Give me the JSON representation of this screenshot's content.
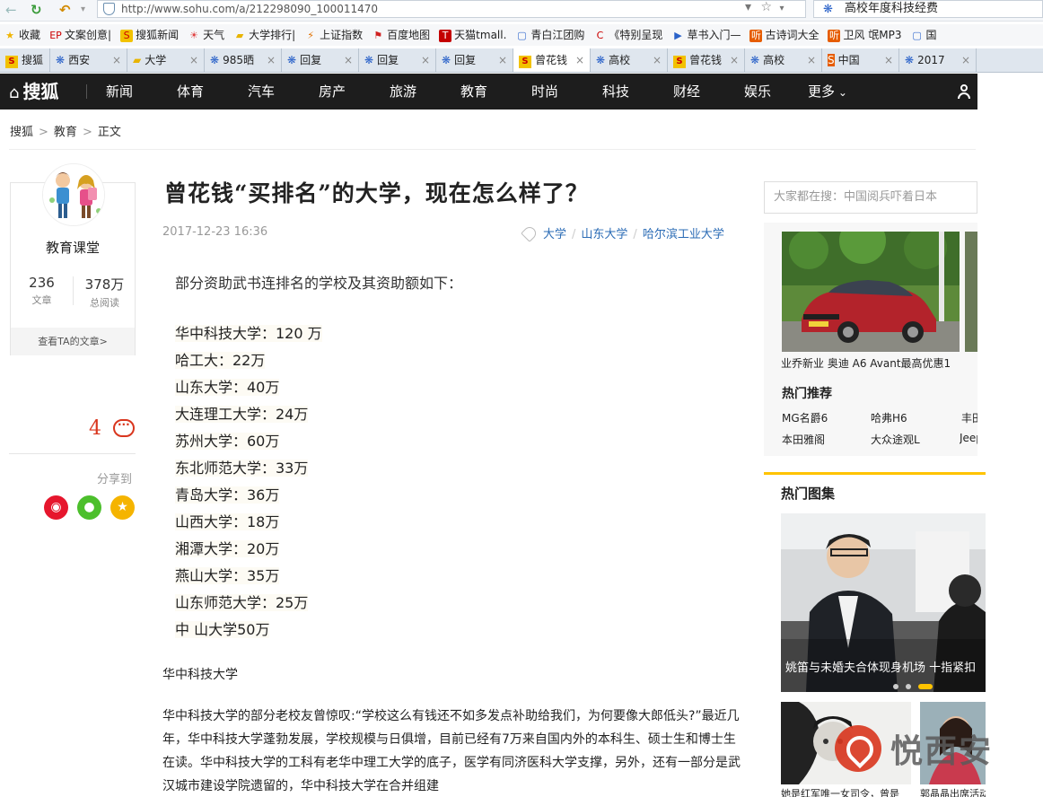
{
  "browser": {
    "url": "http://www.sohu.com/a/212298090_100011470",
    "search_query": "高校年度科技经费",
    "bookmarks": [
      {
        "label": "收藏",
        "icon": "star-icon"
      },
      {
        "label": "文案创意|",
        "icon": "ep-icon"
      },
      {
        "label": "搜狐新闻",
        "icon": "sohu-icon"
      },
      {
        "label": "天气",
        "icon": "weather-icon"
      },
      {
        "label": "大学排行|",
        "icon": "folder-icon"
      },
      {
        "label": "上证指数",
        "icon": "stock-icon"
      },
      {
        "label": "百度地图",
        "icon": "map-pin-icon"
      },
      {
        "label": "天猫tmall.",
        "icon": "tmall-icon"
      },
      {
        "label": "青白江团购",
        "icon": "page-icon"
      },
      {
        "label": "《特别呈现",
        "icon": "cctv-icon"
      },
      {
        "label": "草书入门—",
        "icon": "play-icon"
      },
      {
        "label": "古诗词大全",
        "icon": "ting-icon"
      },
      {
        "label": "卫风 氓MP3",
        "icon": "ting-icon"
      },
      {
        "label": "国",
        "icon": "page-icon"
      }
    ],
    "tabs": [
      {
        "label": "搜狐",
        "icon": "sohu-icon",
        "active": false
      },
      {
        "label": "西安",
        "icon": "paw-icon",
        "active": false
      },
      {
        "label": "大学",
        "icon": "folder-icon",
        "active": false
      },
      {
        "label": "985晒",
        "icon": "paw-icon",
        "active": false
      },
      {
        "label": "回复",
        "icon": "paw-icon",
        "active": false
      },
      {
        "label": "回复",
        "icon": "paw-icon",
        "active": false
      },
      {
        "label": "回复",
        "icon": "paw-icon",
        "active": false
      },
      {
        "label": "曾花钱",
        "icon": "sohu-icon",
        "active": true
      },
      {
        "label": "高校",
        "icon": "paw-icon",
        "active": false
      },
      {
        "label": "曾花钱",
        "icon": "sohu-icon",
        "active": false
      },
      {
        "label": "高校",
        "icon": "paw-icon",
        "active": false
      },
      {
        "label": "中国",
        "icon": "sogou-icon",
        "active": false
      },
      {
        "label": "2017",
        "icon": "paw-icon",
        "active": false
      }
    ]
  },
  "site": {
    "logo": "搜狐",
    "nav": [
      "新闻",
      "体育",
      "汽车",
      "房产",
      "旅游",
      "教育",
      "时尚",
      "科技",
      "财经",
      "娱乐",
      "更多"
    ],
    "breadcrumb": [
      "搜狐",
      "教育",
      "正文"
    ]
  },
  "author": {
    "name": "教育课堂",
    "articles": "236",
    "articles_label": "文章",
    "reads": "378万",
    "reads_label": "总阅读",
    "view_link": "查看TA的文章>"
  },
  "social": {
    "comment_count": "4",
    "share_label": "分享到",
    "share_targets": [
      {
        "name": "weibo-icon",
        "color": "#e6162d"
      },
      {
        "name": "wechat-icon",
        "color": "#4cbf2c"
      },
      {
        "name": "qzone-icon",
        "color": "#f5b400"
      }
    ]
  },
  "article": {
    "title": "曾花钱“买排名”的大学，现在怎么样了？",
    "date": "2017-12-23 16:36",
    "tags": [
      "大学",
      "山东大学",
      "哈尔滨工业大学"
    ],
    "intro": "部分资助武书连排名的学校及其资助额如下：",
    "funding": [
      "华中科技大学：120 万",
      "哈工大：22万",
      "山东大学：40万",
      "大连理工大学：24万",
      "苏州大学：60万",
      "东北师范大学：33万",
      "青岛大学：36万",
      "山西大学：18万",
      "湘潭大学：20万",
      "燕山大学：35万",
      "山东师范大学：25万",
      "中 山大学50万"
    ],
    "section_heading": "华中科技大学",
    "paragraph": "华中科技大学的部分老校友曾惊叹:“学校这么有钱还不如多发点补助给我们，为何要像大郎低头?”最近几年，华中科技大学蓬勃发展，学校规模与日俱增，目前已经有7万来自国内外的本科生、硕士生和博士生在读。华中科技大学的工科有老华中理工大学的底子，医学有同济医科大学支撑，另外，还有一部分是武汉城市建设学院遗留的，华中科技大学在合并组建"
  },
  "sidebar": {
    "search_placeholder": "大家都在搜：中国阅兵吓着日本",
    "ad_caption": "业乔新业 奥迪 A6 Avant最高优惠1",
    "hot_rec_heading": "热门推荐",
    "hot_rec": [
      "MG名爵6",
      "哈弗H6",
      "丰田",
      "本田雅阁",
      "大众途观L",
      "Jeep"
    ],
    "gallery_heading": "热门图集",
    "gallery_caption": "姚笛与未婚夫合体现身机场 十指紧扣",
    "thumb_captions": [
      "她是红军唯一女司令，曾是",
      "郭晶晶出席活动"
    ]
  },
  "watermark": "悦西安",
  "colors": {
    "accent": "#d9361e",
    "nav_bg": "#1d1d1d",
    "link": "#2a6bb5",
    "gallery_accent": "#ffc300"
  }
}
